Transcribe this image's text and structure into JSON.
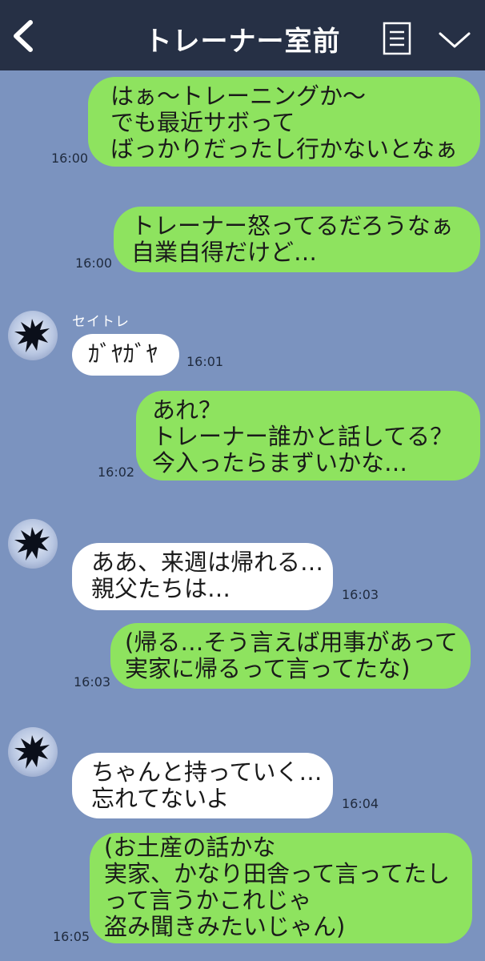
{
  "header": {
    "title": "トレーナー室前",
    "back_icon": "chevron-left-icon",
    "menu_icon": "list-icon",
    "more_icon": "chevron-down-icon"
  },
  "messages": [
    {
      "side": "me",
      "text": "はぁ〜トレーニングか〜\nでも最近サボって\nばっかりだったし行かないとなぁ",
      "time": "16:00"
    },
    {
      "side": "me",
      "text": "トレーナー怒ってるだろうなぁ\n自業自得だけど…",
      "time": "16:00"
    },
    {
      "side": "other",
      "sender": "セイトレ",
      "text": "ｶﾞﾔｶﾞﾔ",
      "time": "16:01"
    },
    {
      "side": "me",
      "text": "あれ？\nトレーナー誰かと話してる？\n今入ったらまずいかな…",
      "time": "16:02"
    },
    {
      "side": "other",
      "text": "ああ、来週は帰れる…\n親父たちは…",
      "time": "16:03"
    },
    {
      "side": "me",
      "text": "(帰る…そう言えば用事があって\n実家に帰るって言ってたな)",
      "time": "16:03"
    },
    {
      "side": "other",
      "text": "ちゃんと持っていく…\n忘れてないよ",
      "time": "16:04"
    },
    {
      "side": "me",
      "text": "(お土産の話かな\n実家、かなり田舎って言ってたし\nって言うかこれじゃ\n盗み聞きみたいじゃん)",
      "time": "16:05"
    }
  ],
  "colors": {
    "background": "#7b93bf",
    "header": "#263045",
    "my_bubble": "#8ee35f",
    "their_bubble": "#ffffff"
  }
}
